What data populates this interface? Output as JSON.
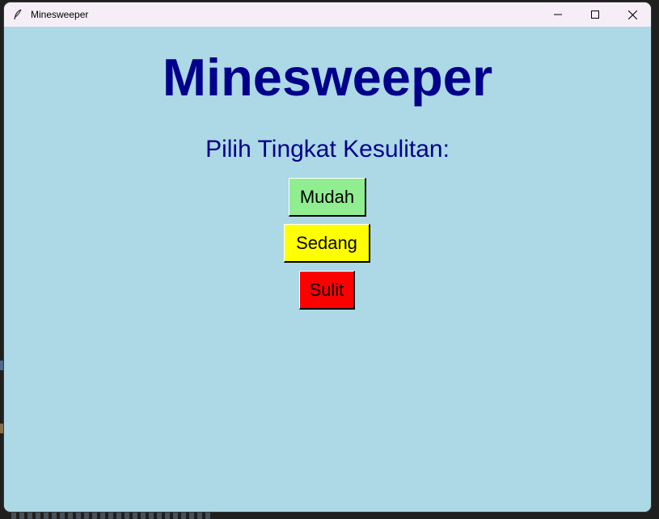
{
  "window": {
    "title": "Minesweeper",
    "icon": "feather-icon",
    "controls": [
      "minimize-icon",
      "maximize-icon",
      "close-icon"
    ]
  },
  "main": {
    "title": "Minesweeper",
    "subtitle": "Pilih Tingkat Kesulitan:",
    "buttons": [
      {
        "label": "Mudah",
        "color": "#90ee90"
      },
      {
        "label": "Sedang",
        "color": "#ffff00"
      },
      {
        "label": "Sulit",
        "color": "#ff0000"
      }
    ]
  },
  "colors": {
    "background": "#add8e6",
    "heading": "#00008b",
    "titlebar": "#f6eef7"
  }
}
